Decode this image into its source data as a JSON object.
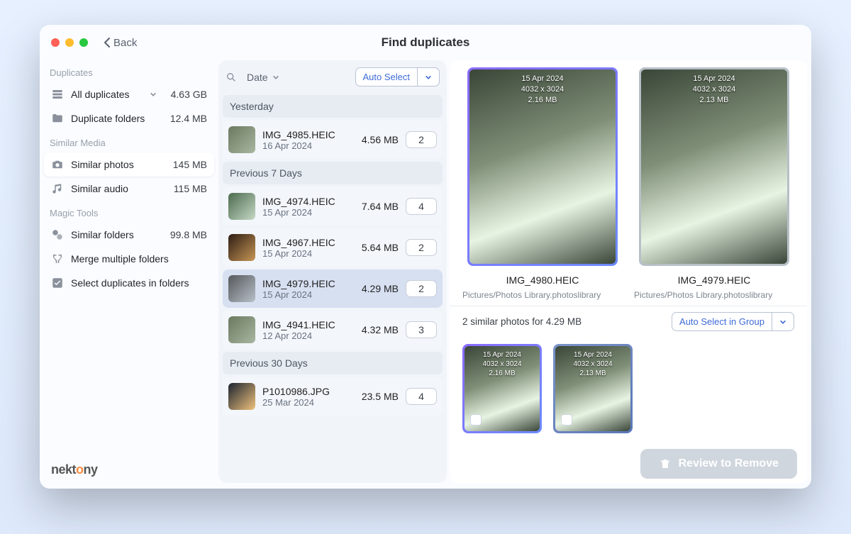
{
  "titlebar": {
    "back": "Back",
    "title": "Find duplicates"
  },
  "sidebar": {
    "duplicates_header": "Duplicates",
    "all_duplicates": {
      "label": "All duplicates",
      "value": "4.63 GB"
    },
    "duplicate_folders": {
      "label": "Duplicate folders",
      "value": "12.4 MB"
    },
    "similar_media_header": "Similar Media",
    "similar_photos": {
      "label": "Similar photos",
      "value": "145 MB"
    },
    "similar_audio": {
      "label": "Similar audio",
      "value": "115 MB"
    },
    "magic_tools_header": "Magic Tools",
    "similar_folders": {
      "label": "Similar folders",
      "value": "99.8 MB"
    },
    "merge_folders": {
      "label": "Merge multiple folders"
    },
    "select_in_folders": {
      "label": "Select duplicates in folders"
    },
    "brand_pre": "nekt",
    "brand_post": "ny"
  },
  "list": {
    "sort_label": "Date",
    "auto_select": "Auto Select",
    "groups": {
      "g0": {
        "header": "Yesterday"
      },
      "g1": {
        "header": "Previous 7 Days"
      },
      "g2": {
        "header": "Previous 30 Days"
      }
    },
    "items": {
      "i0": {
        "name": "IMG_4985.HEIC",
        "date": "16 Apr 2024",
        "size": "4.56 MB",
        "count": "2"
      },
      "i1": {
        "name": "IMG_4974.HEIC",
        "date": "15 Apr 2024",
        "size": "7.64 MB",
        "count": "4"
      },
      "i2": {
        "name": "IMG_4967.HEIC",
        "date": "15 Apr 2024",
        "size": "5.64 MB",
        "count": "2"
      },
      "i3": {
        "name": "IMG_4979.HEIC",
        "date": "15 Apr 2024",
        "size": "4.29 MB",
        "count": "2"
      },
      "i4": {
        "name": "IMG_4941.HEIC",
        "date": "12 Apr 2024",
        "size": "4.32 MB",
        "count": "3"
      },
      "i5": {
        "name": "P1010986.JPG",
        "date": "25 Mar 2024",
        "size": "23.5 MB",
        "count": "4"
      }
    }
  },
  "detail": {
    "left": {
      "name": "IMG_4980.HEIC",
      "path": "Pictures/Photos Library.photoslibrary",
      "meta1": "15 Apr 2024",
      "meta2": "4032 x 3024",
      "meta3": "2.16 MB"
    },
    "right": {
      "name": "IMG_4979.HEIC",
      "path": "Pictures/Photos Library.photoslibrary",
      "meta1": "15 Apr 2024",
      "meta2": "4032 x 3024",
      "meta3": "2.13 MB"
    },
    "group_info": "2 similar photos for 4.29 MB",
    "auto_select_group": "Auto Select in Group",
    "mini": {
      "m0": {
        "meta1": "15 Apr 2024",
        "meta2": "4032 x 3024",
        "meta3": "2.16 MB"
      },
      "m1": {
        "meta1": "15 Apr 2024",
        "meta2": "4032 x 3024",
        "meta3": "2.13 MB"
      }
    },
    "review_button": "Review to Remove"
  }
}
